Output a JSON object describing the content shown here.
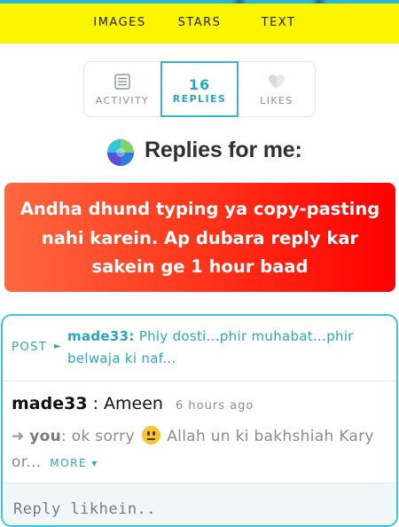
{
  "top_nav": {
    "items": [
      "IMAGES",
      "STARS",
      "TEXT"
    ]
  },
  "tabs": [
    {
      "label": "ACTIVITY",
      "icon": "activity-icon"
    },
    {
      "label": "REPLIES",
      "count": "16",
      "active": true
    },
    {
      "label": "LIKES",
      "icon": "heart-icon"
    }
  ],
  "heading": {
    "icon": "app-logo-icon",
    "text": "Replies for me:"
  },
  "alert": {
    "lines": [
      "Andha dhund typing ya copy-pasting",
      "nahi karein. Ap dubara reply kar",
      "sakein ge 1 hour baad"
    ]
  },
  "reply_card": {
    "post_tag": "POST",
    "post_user": "made33:",
    "post_text": "Phly dosti...phir muhabat...phir belwaja ki naf...",
    "reply_user": "made33",
    "reply_sep": ":",
    "reply_text": "Ameen",
    "reply_time": "6 hours ago",
    "quote_arrow": "➜",
    "quote_user": "you",
    "quote_text_before": ": ok sorry",
    "quote_emoji": "neutral-face-emoji",
    "quote_text_after": "Allah un ki bakhshiah Kary or...",
    "more_label": "MORE ▾",
    "reply_placeholder": "Reply likhein.."
  },
  "colors": {
    "nav_bg": "#fbf500",
    "accent": "#2aa6c4",
    "alert_start": "#ff6840",
    "alert_end": "#ff0000"
  }
}
